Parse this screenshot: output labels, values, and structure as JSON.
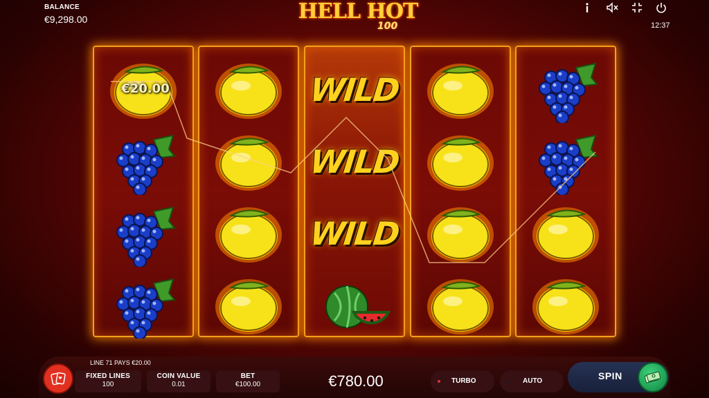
{
  "header": {
    "balance_label": "BALANCE",
    "balance_value": "€9,298.00",
    "logo_main": "HELL HOT",
    "logo_sub": "100",
    "clock": "12:37",
    "icons": [
      "info-icon",
      "sound-off-icon",
      "fullscreen-icon",
      "power-icon"
    ]
  },
  "reels": [
    [
      "lemon",
      "grapes",
      "grapes",
      "grapes"
    ],
    [
      "lemon",
      "lemon",
      "lemon",
      "lemon"
    ],
    [
      "wild",
      "wild",
      "wild",
      "watermelon"
    ],
    [
      "lemon",
      "lemon",
      "lemon",
      "lemon"
    ],
    [
      "grapes",
      "grapes",
      "lemon",
      "lemon"
    ]
  ],
  "wild_label": "WILD",
  "win_amount": "€20.00",
  "footer": {
    "line_info": "LINE 71 PAYS €20.00",
    "fixed_lines_label": "FIXED LINES",
    "fixed_lines_value": "100",
    "coin_value_label": "COIN VALUE",
    "coin_value_value": "0.01",
    "bet_label": "BET",
    "bet_value": "€100.00",
    "total_bet": "€780.00",
    "turbo_label": "TURBO",
    "auto_label": "AUTO",
    "spin_label": "SPIN"
  },
  "colors": {
    "reel_border": "#f2a11d",
    "wild_text": "#ffd21f",
    "spin_button": "#1fa354",
    "background": "#5a0604"
  }
}
